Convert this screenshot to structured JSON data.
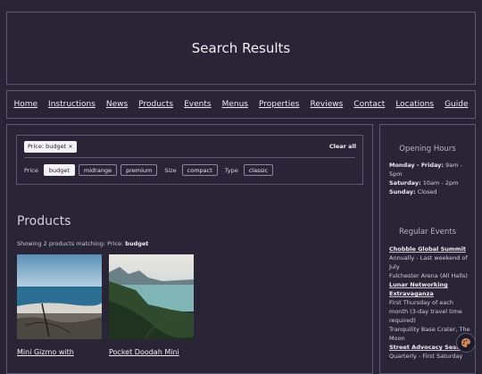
{
  "header": {
    "title": "Search Results"
  },
  "nav": {
    "items": [
      "Home",
      "Instructions",
      "News",
      "Products",
      "Events",
      "Menus",
      "Properties",
      "Reviews",
      "Contact",
      "Locations",
      "Guide"
    ]
  },
  "filters": {
    "active_chip": "Price: budget ×",
    "clear_label": "Clear all",
    "price_label": "Price",
    "price_options": [
      "budget",
      "midrange",
      "premium"
    ],
    "size_label": "Size",
    "size_options": [
      "compact"
    ],
    "type_label": "Type",
    "type_options": [
      "classic"
    ]
  },
  "products": {
    "heading": "Products",
    "showing_prefix": "Showing 2 products matching: Price: ",
    "showing_value": "budget",
    "items": [
      {
        "name": "Mini Gizmo with"
      },
      {
        "name": "Pocket Doodah Mini"
      }
    ]
  },
  "sidebar": {
    "hours_heading": "Opening Hours",
    "hours": [
      {
        "day": "Monday - Friday:",
        "time": "9am - 5pm"
      },
      {
        "day": "Saturday:",
        "time": "10am - 2pm"
      },
      {
        "day": "Sunday:",
        "time": "Closed"
      }
    ],
    "events_heading": "Regular Events",
    "events": [
      {
        "title": "Chobble Global Summit",
        "details": [
          "Annually - Last weekend of July",
          "Fulchester Arena (All Halls)"
        ]
      },
      {
        "title": "Lunar Networking Extravaganza",
        "details": [
          "First Thursday of each month (3-day travel time required)",
          "Tranquility Base Crater, The Moon"
        ]
      },
      {
        "title": "Street Advocacy Session",
        "details": [
          "Quarterly - First Saturday"
        ]
      }
    ]
  }
}
